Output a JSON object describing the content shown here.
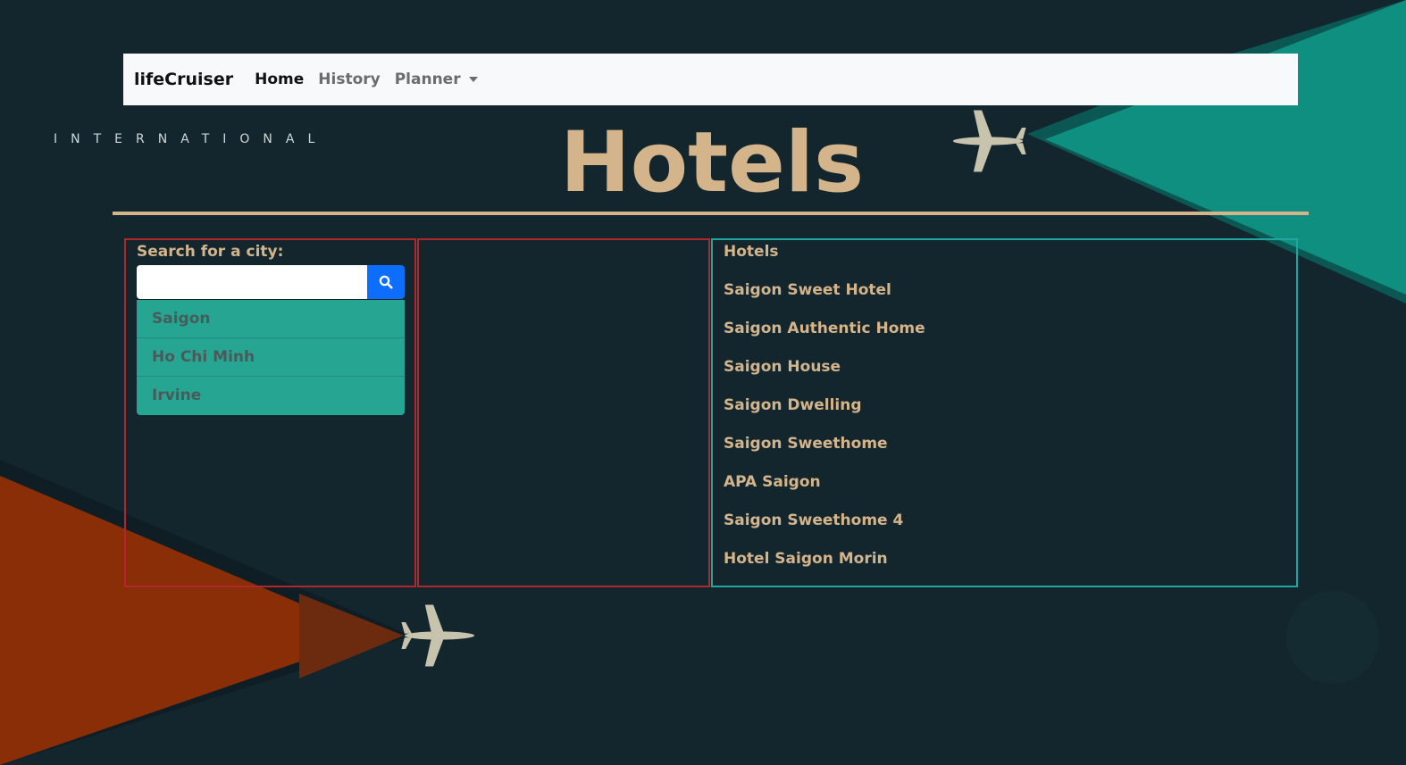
{
  "navbar": {
    "brand": "lifeCruiser",
    "links": [
      {
        "label": "Home",
        "active": true
      },
      {
        "label": "History",
        "active": false
      },
      {
        "label": "Planner",
        "active": false
      }
    ]
  },
  "hero": {
    "tagline": "INTERNATIONAL",
    "title": "Hotels"
  },
  "search": {
    "label": "Search for a city:",
    "value": "",
    "placeholder": "",
    "button_icon": "search-icon",
    "suggestions": [
      "Saigon",
      "Ho Chi Minh",
      "Irvine"
    ]
  },
  "hotels": {
    "heading": "Hotels",
    "items": [
      "Saigon Sweet Hotel",
      "Saigon Authentic Home",
      "Saigon House",
      "Saigon Dwelling",
      "Saigon Sweethome",
      "APA Saigon",
      "Saigon Sweethome 4",
      "Hotel Saigon Morin"
    ]
  },
  "colors": {
    "background": "#13262d",
    "accent_gold": "#d4b48b",
    "teal": "#0f8f80",
    "orange": "#8a2e08",
    "panel_red": "#b0282c",
    "panel_teal": "#1fa6a0",
    "search_blue": "#0d6efd",
    "suggestion_bg": "#26a692"
  }
}
